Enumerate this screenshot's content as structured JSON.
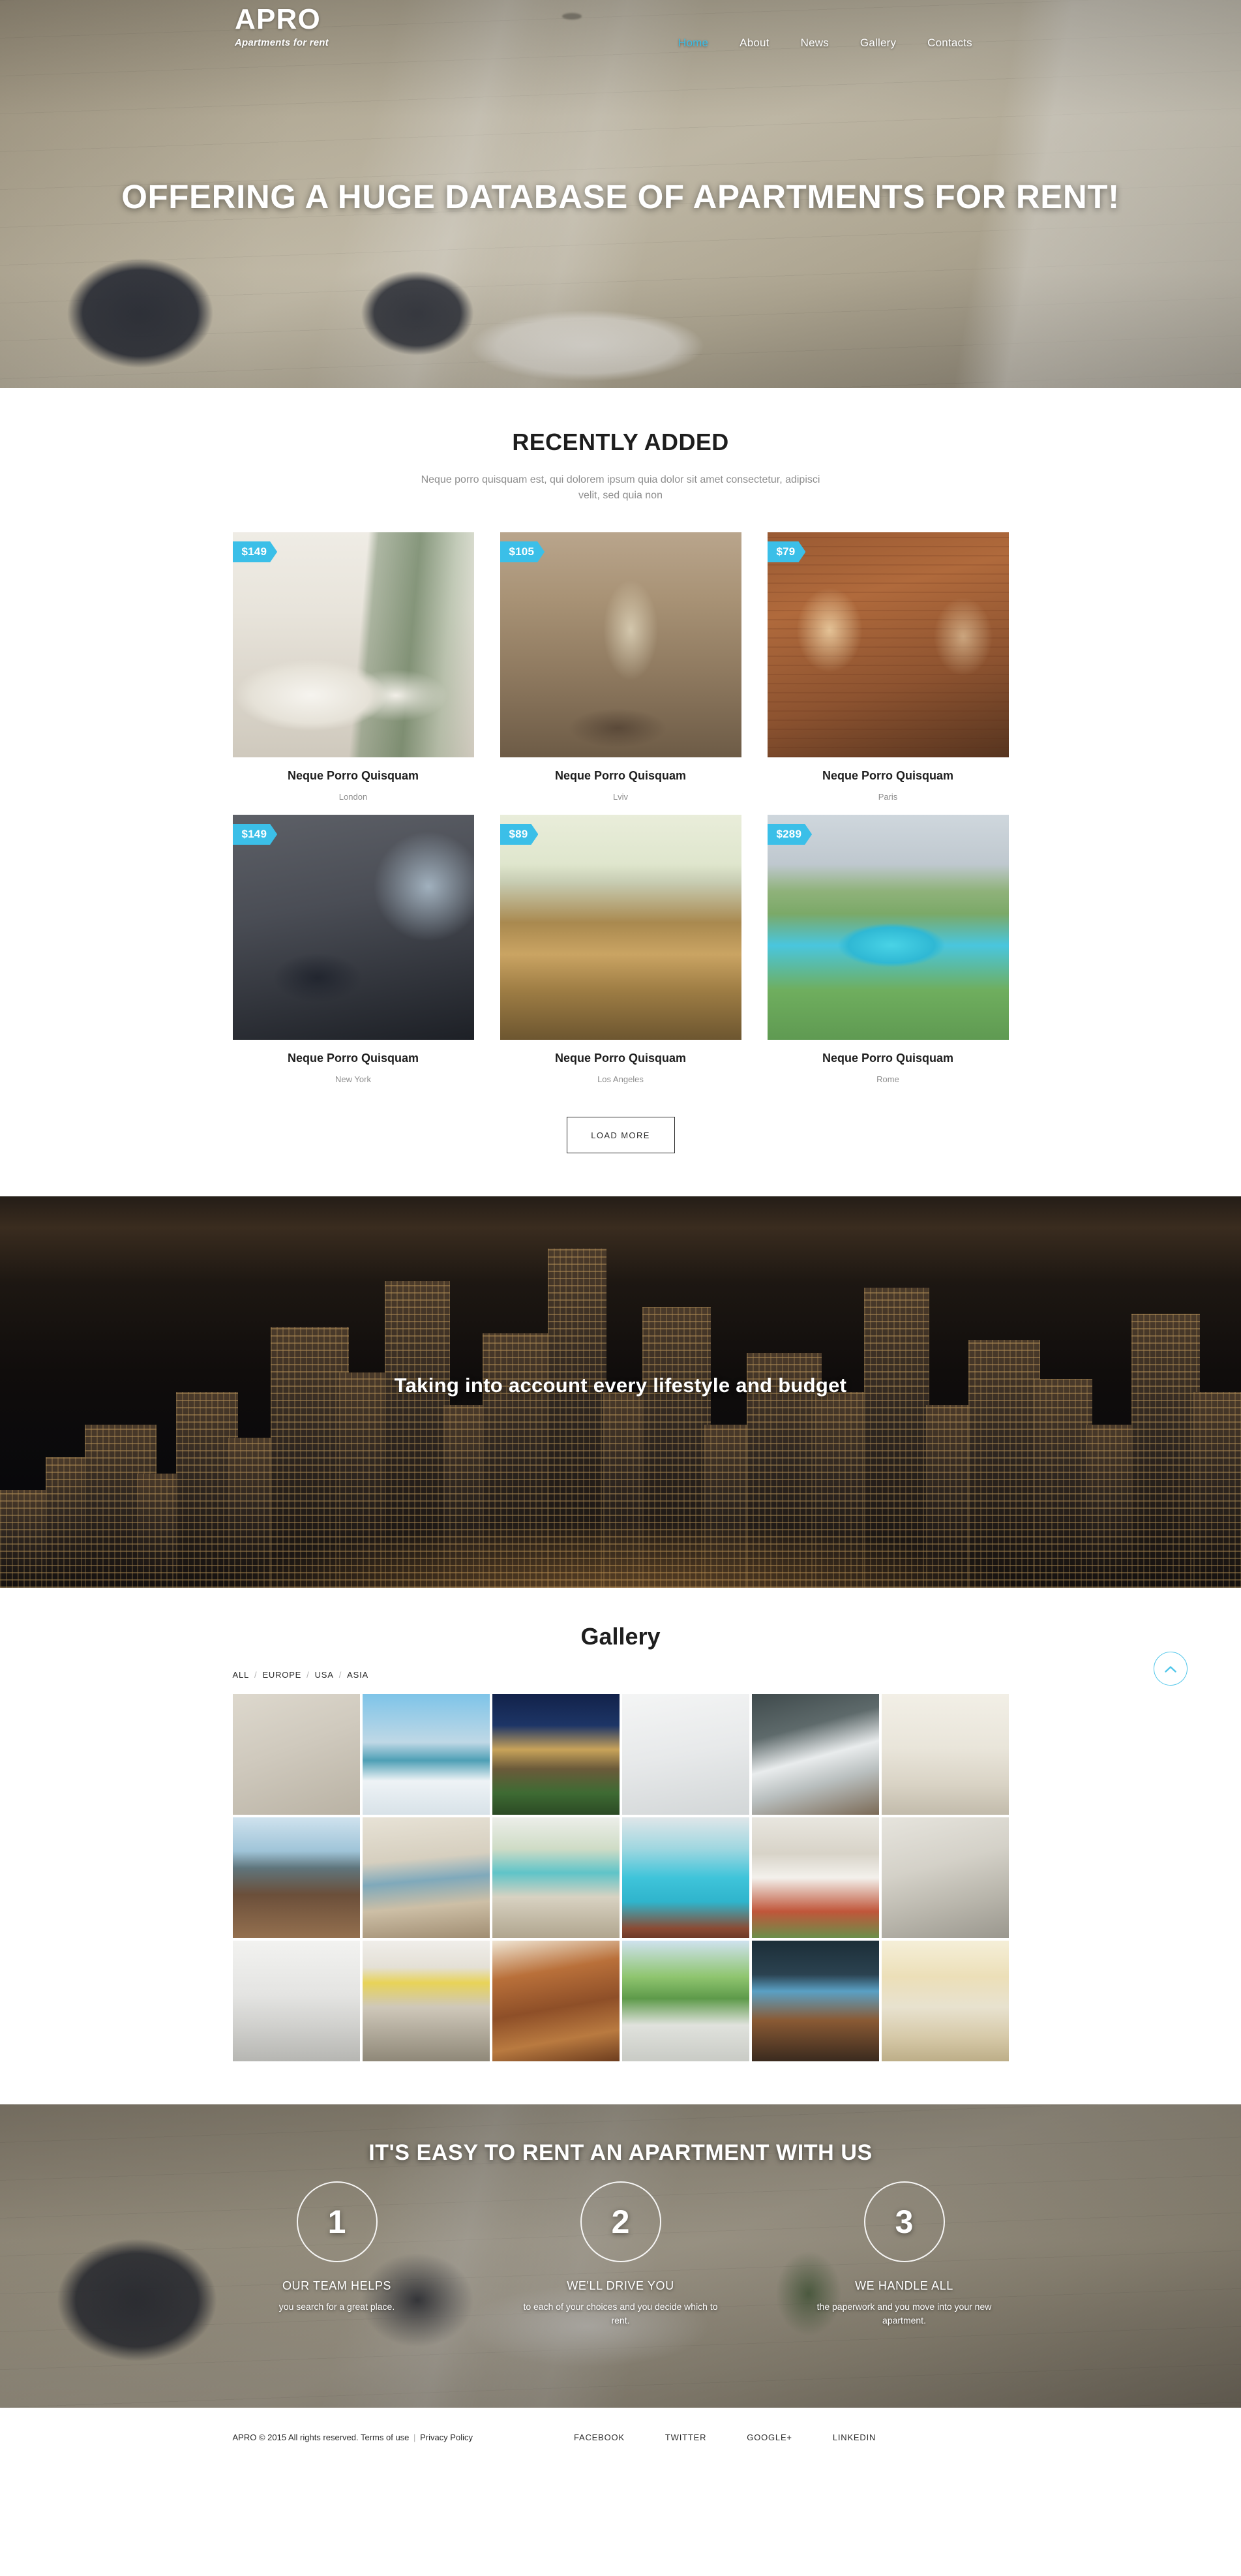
{
  "brand": {
    "name": "APRO",
    "tagline": "Apartments for rent"
  },
  "nav": {
    "items": [
      {
        "label": "Home",
        "active": true
      },
      {
        "label": "About",
        "active": false
      },
      {
        "label": "News",
        "active": false
      },
      {
        "label": "Gallery",
        "active": false
      },
      {
        "label": "Contacts",
        "active": false
      }
    ]
  },
  "hero": {
    "title": "OFFERING A HUGE DATABASE OF APARTMENTS FOR RENT!"
  },
  "recent": {
    "title": "RECENTLY ADDED",
    "subtitle": "Neque porro quisquam est, qui dolorem ipsum quia dolor sit amet consectetur, adipisci velit, sed quia non",
    "load_more_label": "LOAD MORE",
    "cards": [
      {
        "price": "$149",
        "name": "Neque Porro Quisquam",
        "location": "London",
        "photo": "ph-bedroom"
      },
      {
        "price": "$105",
        "name": "Neque Porro Quisquam",
        "location": "Lviv",
        "photo": "ph-living1"
      },
      {
        "price": "$79",
        "name": "Neque Porro Quisquam",
        "location": "Paris",
        "photo": "ph-brick"
      },
      {
        "price": "$149",
        "name": "Neque Porro Quisquam",
        "location": "New York",
        "photo": "ph-loft"
      },
      {
        "price": "$89",
        "name": "Neque Porro Quisquam",
        "location": "Los Angeles",
        "photo": "ph-kitchen"
      },
      {
        "price": "$289",
        "name": "Neque Porro Quisquam",
        "location": "Rome",
        "photo": "ph-pool"
      }
    ]
  },
  "parallax": {
    "title": "Taking into account every lifestyle and budget"
  },
  "gallery": {
    "title": "Gallery",
    "filters": [
      "ALL",
      "EUROPE",
      "USA",
      "ASIA"
    ],
    "filter_separator": "/",
    "scroll_top_icon": "chevron-up-icon",
    "tiles": [
      "g1",
      "g2",
      "g3",
      "g4",
      "g5",
      "g6",
      "g7",
      "g8",
      "g9",
      "g10",
      "g11",
      "g12",
      "g13",
      "g14",
      "g15",
      "g16",
      "g17",
      "g18"
    ]
  },
  "steps": {
    "title": "IT'S EASY TO RENT AN APARTMENT WITH US",
    "items": [
      {
        "number": "1",
        "title": "OUR TEAM HELPS",
        "text": "you search for a great place."
      },
      {
        "number": "2",
        "title": "WE'LL DRIVE YOU",
        "text": "to each of your choices and you decide which to rent."
      },
      {
        "number": "3",
        "title": "WE HANDLE ALL",
        "text": "the paperwork and you move into your new apartment."
      }
    ]
  },
  "footer": {
    "copyright": "APRO © 2015 All rights reserved.",
    "terms_label": "Terms of use",
    "separator": "|",
    "privacy_label": "Privacy Policy",
    "socials": [
      "FACEBOOK",
      "TWITTER",
      "GOOGLE+",
      "LINKEDIN"
    ]
  },
  "colors": {
    "accent": "#3bbfe8",
    "text": "#1e1e1e",
    "muted": "#8e8e8e",
    "background": "#ffffff"
  }
}
